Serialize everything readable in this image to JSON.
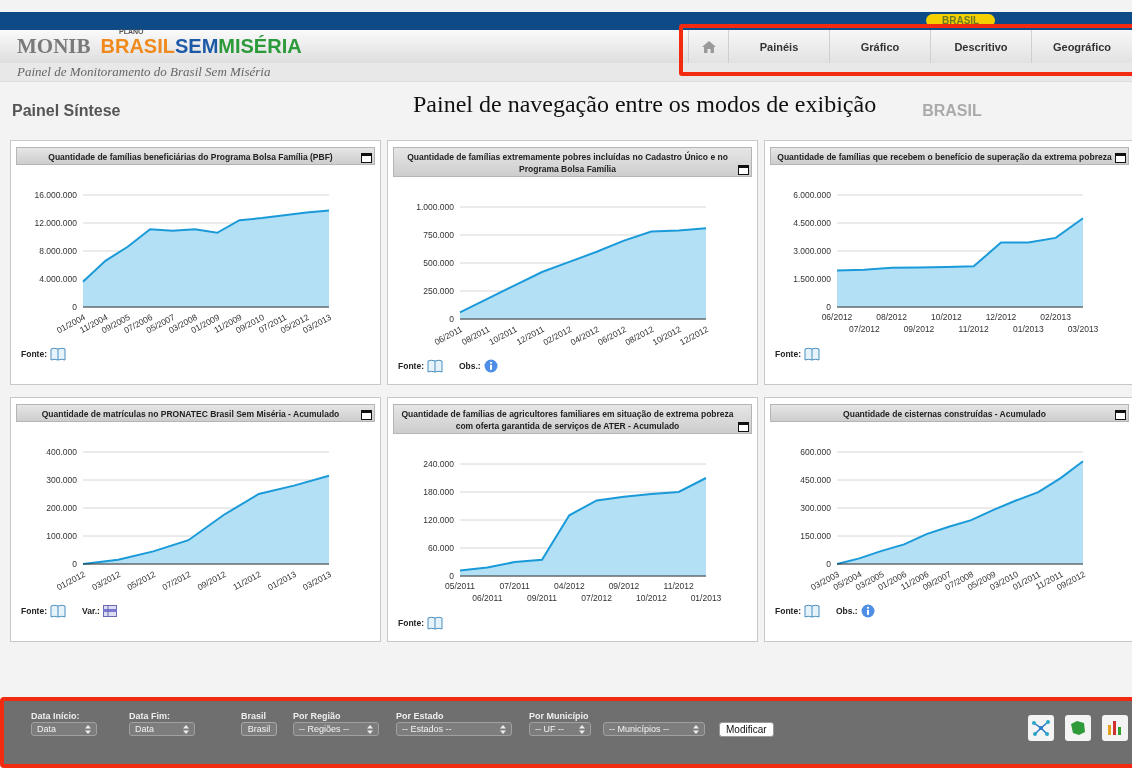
{
  "header": {
    "badge": "BRASIL",
    "logo": {
      "monib": "MONIB",
      "plano": "PLANO",
      "brasil": "BRASIL",
      "sem": "SEM",
      "miseria": "MISÉRIA"
    },
    "subtitle": "Painel de Monitoramento do Brasil Sem Miséria"
  },
  "nav": {
    "items": [
      {
        "label": "Painéis"
      },
      {
        "label": "Gráfico"
      },
      {
        "label": "Descritivo"
      },
      {
        "label": "Geográfico"
      }
    ]
  },
  "page": {
    "title": "Painel Síntese",
    "annotation": "Painel de navegação entre os modos de exibição",
    "region": "BRASIL"
  },
  "panels": [
    {
      "title": "Quantidade de famílias beneficiárias do Programa Bolsa Família (PBF)",
      "chart_data": {
        "type": "area",
        "categories": [
          "01/2004",
          "11/2004",
          "09/2005",
          "07/2006",
          "05/2007",
          "03/2008",
          "01/2009",
          "11/2009",
          "09/2010",
          "07/2011",
          "05/2012",
          "03/2013"
        ],
        "values": [
          3600000,
          6600000,
          8600000,
          11100000,
          10900000,
          11100000,
          10600000,
          12400000,
          12700000,
          13100000,
          13500000,
          13800000
        ],
        "grid": true,
        "ylim": [
          0,
          16000000
        ],
        "yticks": [
          {
            "value": 0,
            "label": "0"
          },
          {
            "value": 4000000,
            "label": "4.000.000"
          },
          {
            "value": 8000000,
            "label": "8.000.000"
          },
          {
            "value": 12000000,
            "label": "12.000.000"
          },
          {
            "value": 16000000,
            "label": "16.000.000"
          }
        ]
      },
      "footer": [
        {
          "kind": "source",
          "label": "Fonte:"
        }
      ]
    },
    {
      "title": "Quantidade de famílias extremamente pobres incluídas no Cadastro Único e no Programa Bolsa Família",
      "chart_data": {
        "type": "area",
        "categories": [
          "06/2011",
          "08/2011",
          "10/2011",
          "12/2011",
          "02/2012",
          "04/2012",
          "06/2012",
          "08/2012",
          "10/2012",
          "12/2012"
        ],
        "values": [
          60000,
          180000,
          300000,
          420000,
          510000,
          600000,
          700000,
          780000,
          790000,
          810000
        ],
        "grid": true,
        "ylim": [
          0,
          1000000
        ],
        "yticks": [
          {
            "value": 0,
            "label": "0"
          },
          {
            "value": 250000,
            "label": "250.000"
          },
          {
            "value": 500000,
            "label": "500.000"
          },
          {
            "value": 750000,
            "label": "750.000"
          },
          {
            "value": 1000000,
            "label": "1.000.000"
          }
        ]
      },
      "footer": [
        {
          "kind": "source",
          "label": "Fonte:"
        },
        {
          "kind": "note",
          "label": "Obs.:"
        }
      ]
    },
    {
      "title": "Quantidade de famílias que recebem o benefício de superação da extrema pobreza",
      "chart_data": {
        "type": "area",
        "categories": [
          "06/2012",
          "07/2012",
          "08/2012",
          "09/2012",
          "10/2012",
          "11/2012",
          "12/2012",
          "01/2013",
          "02/2013",
          "03/2013"
        ],
        "values": [
          1950000,
          2000000,
          2100000,
          2120000,
          2150000,
          2180000,
          3450000,
          3450000,
          3700000,
          4750000
        ],
        "grid": true,
        "ylim": [
          0,
          6000000
        ],
        "yticks": [
          {
            "value": 0,
            "label": "0"
          },
          {
            "value": 1500000,
            "label": "1.500.000"
          },
          {
            "value": 3000000,
            "label": "3.000.000"
          },
          {
            "value": 4500000,
            "label": "4.500.000"
          },
          {
            "value": 6000000,
            "label": "6.000.000"
          }
        ]
      },
      "footer": [
        {
          "kind": "source",
          "label": "Fonte:"
        }
      ]
    },
    {
      "title": "Quantidade de matrículas no PRONATEC Brasil Sem Miséria - Acumulado",
      "chart_data": {
        "type": "area",
        "categories": [
          "01/2012",
          "03/2012",
          "05/2012",
          "07/2012",
          "09/2012",
          "11/2012",
          "01/2013",
          "03/2013"
        ],
        "values": [
          0,
          15000,
          45000,
          85000,
          175000,
          250000,
          280000,
          315000
        ],
        "grid": true,
        "ylim": [
          0,
          400000
        ],
        "yticks": [
          {
            "value": 0,
            "label": "0"
          },
          {
            "value": 100000,
            "label": "100.000"
          },
          {
            "value": 200000,
            "label": "200.000"
          },
          {
            "value": 300000,
            "label": "300.000"
          },
          {
            "value": 400000,
            "label": "400.000"
          }
        ]
      },
      "footer": [
        {
          "kind": "source",
          "label": "Fonte:"
        },
        {
          "kind": "variables",
          "label": "Var.:"
        }
      ]
    },
    {
      "title": "Quantidade de famílias de agricultores familiares em situação de extrema pobreza com oferta garantida de serviços de ATER - Acumulado",
      "chart_data": {
        "type": "area",
        "categories": [
          "05/2011",
          "06/2011",
          "07/2011",
          "09/2011",
          "04/2012",
          "07/2012",
          "09/2012",
          "10/2012",
          "11/2012",
          "01/2013"
        ],
        "values": [
          12000,
          18000,
          30000,
          35000,
          130000,
          162000,
          170000,
          176000,
          180000,
          210000
        ],
        "grid": true,
        "ylim": [
          0,
          240000
        ],
        "yticks": [
          {
            "value": 0,
            "label": "0"
          },
          {
            "value": 60000,
            "label": "60.000"
          },
          {
            "value": 120000,
            "label": "120.000"
          },
          {
            "value": 180000,
            "label": "180.000"
          },
          {
            "value": 240000,
            "label": "240.000"
          }
        ]
      },
      "footer": [
        {
          "kind": "source",
          "label": "Fonte:"
        }
      ]
    },
    {
      "title": "Quantidade de cisternas construídas - Acumulado",
      "chart_data": {
        "type": "area",
        "categories": [
          "03/2003",
          "05/2004",
          "03/2005",
          "01/2006",
          "11/2006",
          "09/2007",
          "07/2008",
          "05/2009",
          "03/2010",
          "01/2011",
          "11/2011",
          "09/2012"
        ],
        "values": [
          0,
          30000,
          70000,
          105000,
          160000,
          200000,
          235000,
          290000,
          340000,
          385000,
          460000,
          550000
        ],
        "grid": true,
        "ylim": [
          0,
          600000
        ],
        "yticks": [
          {
            "value": 0,
            "label": "0"
          },
          {
            "value": 150000,
            "label": "150.000"
          },
          {
            "value": 300000,
            "label": "300.000"
          },
          {
            "value": 450000,
            "label": "450.000"
          },
          {
            "value": 600000,
            "label": "600.000"
          }
        ]
      },
      "footer": [
        {
          "kind": "source",
          "label": "Fonte:"
        },
        {
          "kind": "note",
          "label": "Obs.:"
        }
      ]
    }
  ],
  "filters": {
    "items": [
      {
        "kind": "select",
        "label": "Data Início:",
        "value": "Data",
        "disabled": true
      },
      {
        "kind": "select",
        "label": "Data Fim:",
        "value": "Data",
        "disabled": true
      },
      {
        "kind": "button",
        "label": "Brasil",
        "value": "Brasil",
        "disabled": true
      },
      {
        "kind": "select",
        "label": "Por Região",
        "value": "-- Regiões --",
        "disabled": true
      },
      {
        "kind": "select",
        "label": "Por Estado",
        "value": "-- Estados --",
        "disabled": true
      },
      {
        "kind": "select",
        "label": "Por Município",
        "value": "-- UF --",
        "disabled": true
      },
      {
        "kind": "select",
        "value": "-- Municípios --",
        "disabled": true
      }
    ],
    "submit": "Modificar"
  }
}
